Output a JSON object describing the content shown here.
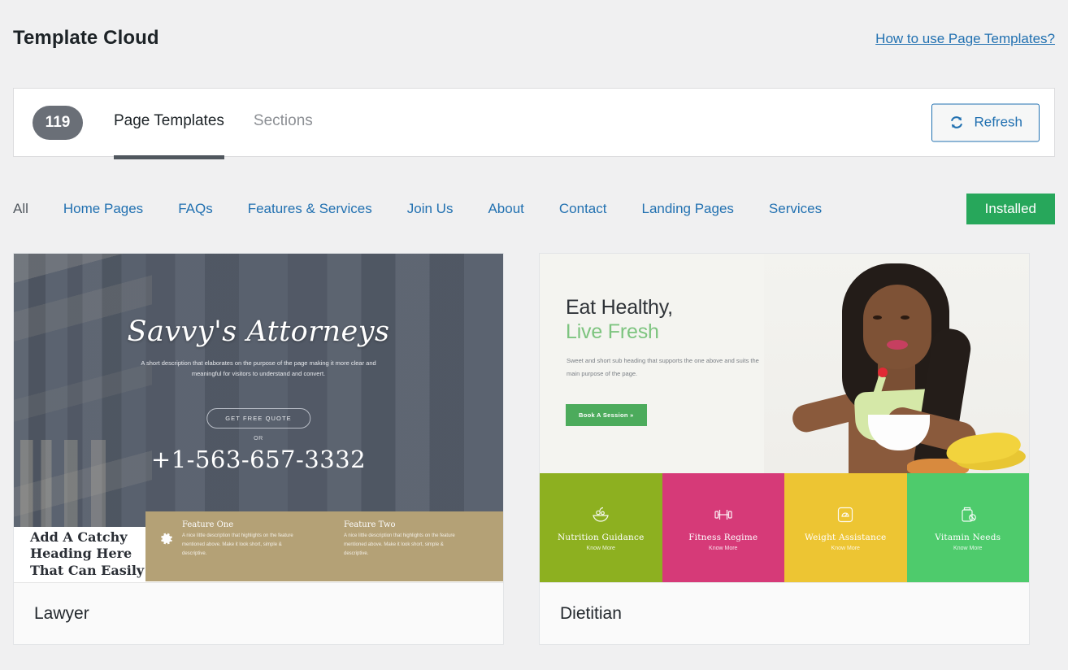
{
  "header": {
    "title": "Template Cloud",
    "help_link": "How to use Page Templates?"
  },
  "tabs_panel": {
    "count_badge": "119",
    "tabs": [
      {
        "label": "Page Templates",
        "active": true
      },
      {
        "label": "Sections",
        "active": false
      }
    ],
    "refresh_label": "Refresh",
    "refresh_icon": "refresh-icon"
  },
  "filters": {
    "items": [
      {
        "label": "All",
        "current": true
      },
      {
        "label": "Home Pages",
        "current": false
      },
      {
        "label": "FAQs",
        "current": false
      },
      {
        "label": "Features & Services",
        "current": false
      },
      {
        "label": "Join Us",
        "current": false
      },
      {
        "label": "About",
        "current": false
      },
      {
        "label": "Contact",
        "current": false
      },
      {
        "label": "Landing Pages",
        "current": false
      },
      {
        "label": "Services",
        "current": false
      }
    ],
    "installed_label": "Installed",
    "installed_color": "#27a75b"
  },
  "cards": [
    {
      "name": "Lawyer",
      "preview": {
        "hero_title": "Savvy's Attorneys",
        "hero_sub": "A short description that elaborates on the purpose of the page making it more clear and meaningful for visitors to understand and convert.",
        "cta_label": "GET FREE QUOTE",
        "or_label": "OR",
        "phone": "+1-563-657-3332",
        "catchy_heading": "Add A Catchy Heading Here That Can Easily",
        "features": [
          {
            "icon": "gear-icon",
            "title": "Feature One",
            "text": "A nice little description that highlights on the feature mentioned above. Make it look short, simple & descriptive."
          },
          {
            "icon": "document-icon",
            "title": "Feature Two",
            "text": "A nice little description that highlights on the feature mentioned above. Make it look short, simple & descriptive."
          }
        ],
        "feature_bg": "#b4a176",
        "hero_bg": "#565e6b"
      }
    },
    {
      "name": "Dietitian",
      "preview": {
        "heading_line1": "Eat Healthy,",
        "heading_line2": "Live Fresh",
        "sub": "Sweet and short sub heading that supports the one above and suits the main purpose of the page.",
        "cta_label": "Book A Session »",
        "cta_color": "#4cab5c",
        "blocks": [
          {
            "icon": "salad-bowl-icon",
            "title": "Nutrition Guidance",
            "more": "Know More",
            "color": "#8db020"
          },
          {
            "icon": "dumbbell-icon",
            "title": "Fitness Regime",
            "more": "Know More",
            "color": "#d63a78"
          },
          {
            "icon": "scale-icon",
            "title": "Weight Assistance",
            "more": "Know More",
            "color": "#edc533"
          },
          {
            "icon": "vitamin-bottle-icon",
            "title": "Vitamin Needs",
            "more": "Know More",
            "color": "#4ecb6c"
          }
        ]
      }
    }
  ]
}
